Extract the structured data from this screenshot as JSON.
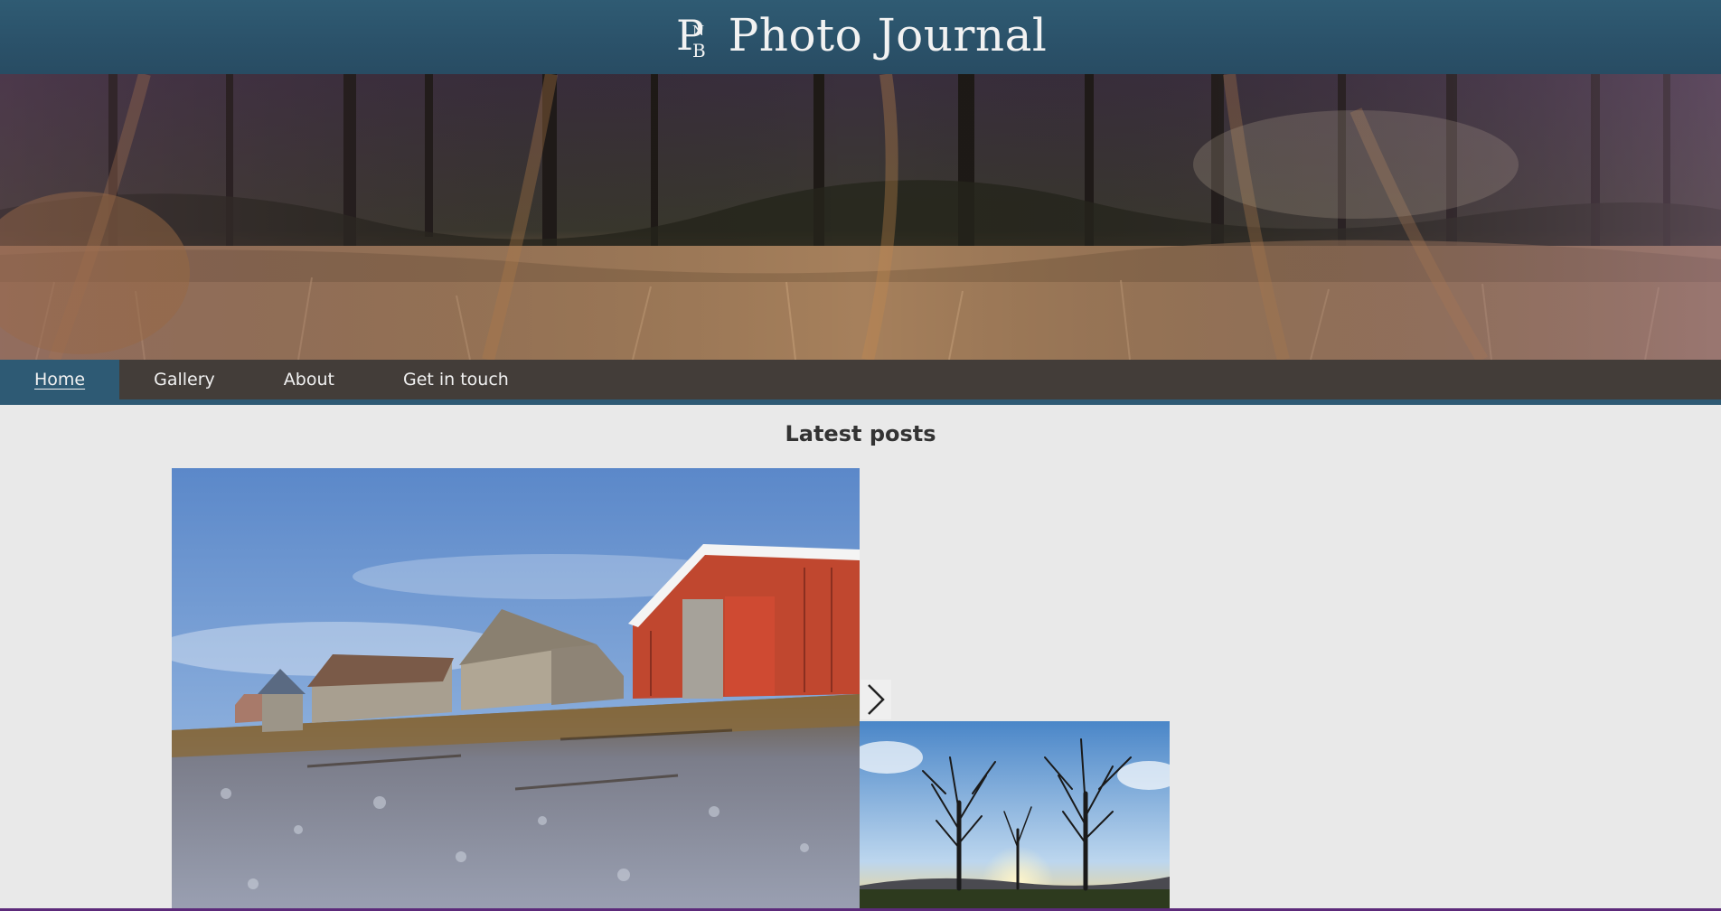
{
  "header": {
    "logo_letters": "PNB",
    "site_title": "Photo Journal"
  },
  "nav": {
    "items": [
      {
        "label": "Home",
        "active": true
      },
      {
        "label": "Gallery",
        "active": false
      },
      {
        "label": "About",
        "active": false
      },
      {
        "label": "Get in touch",
        "active": false
      }
    ]
  },
  "main": {
    "section_title": "Latest posts",
    "posts": [
      {
        "image_description": "red and grey wooden boathouses on a stony shore"
      },
      {
        "image_description": "two bare trees silhouetted against a sunset"
      }
    ],
    "next_icon": "chevron-right-icon"
  },
  "colors": {
    "header_bg": "#2b526a",
    "nav_bg": "#3a342f",
    "nav_active": "#2e5a74",
    "page_bg": "#e9e9e9"
  }
}
